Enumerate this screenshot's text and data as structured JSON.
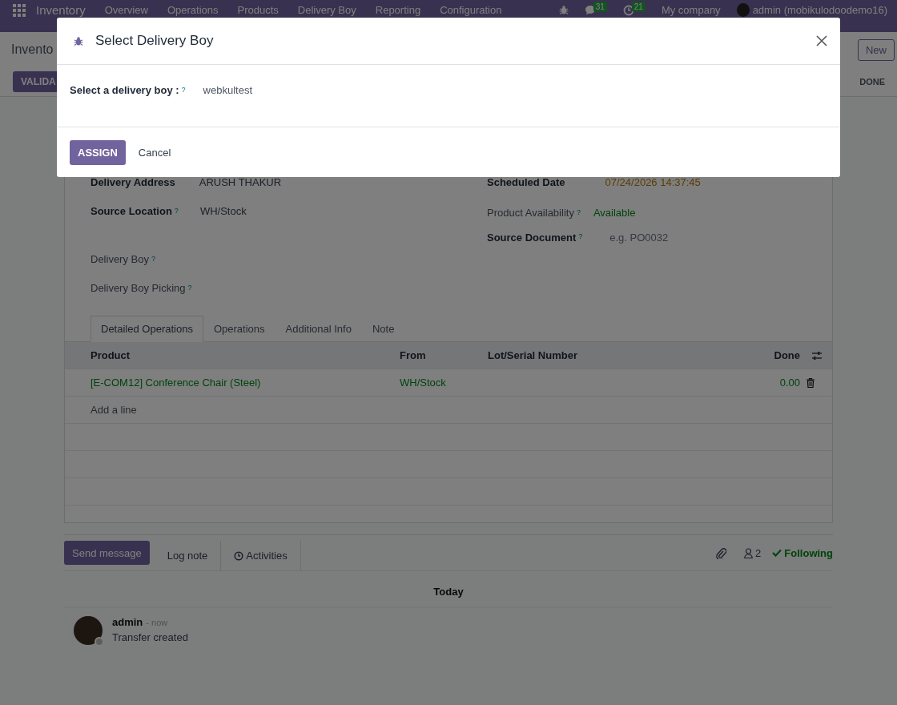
{
  "navbar": {
    "app": "Inventory",
    "menu": [
      "Overview",
      "Operations",
      "Products",
      "Delivery Boy",
      "Reporting",
      "Configuration"
    ],
    "messages_count": "31",
    "activities_count": "21",
    "company": "My company",
    "user": "admin (mobikulodoodemo16)"
  },
  "control_panel": {
    "breadcrumb": "Invento",
    "new_button": "New",
    "action_button": "VALIDA",
    "status": "DONE"
  },
  "form": {
    "left": [
      {
        "label": "Delivery Address",
        "required": true,
        "value": "ARUSH THAKUR",
        "kind": "text"
      },
      {
        "label": "Source Location",
        "required": true,
        "help": "?",
        "value": "WH/Stock",
        "kind": "text"
      },
      {
        "label": "Delivery Boy",
        "required": false,
        "help": "?",
        "kind": "text"
      },
      {
        "label": "Delivery Boy Picking",
        "required": false,
        "help": "?",
        "kind": "text"
      }
    ],
    "right": [
      {
        "label": "Scheduled Date",
        "required": true,
        "value": "07/24/2026 14:37:45",
        "kind": "date"
      },
      {
        "label": "Product Availability",
        "required": false,
        "help": "?",
        "value": "Available",
        "kind": "status"
      },
      {
        "label": "Source Document",
        "required": true,
        "help": "?",
        "placeholder": "e.g. PO0032",
        "kind": "input"
      }
    ]
  },
  "tabs": [
    {
      "label": "Detailed Operations",
      "selected": true
    },
    {
      "label": "Operations",
      "selected": false
    },
    {
      "label": "Additional Info",
      "selected": false
    },
    {
      "label": "Note",
      "selected": false
    }
  ],
  "table": {
    "columns": [
      "Product",
      "From",
      "Lot/Serial Number",
      "Done"
    ],
    "rows": [
      {
        "product": "[E-COM12] Conference Chair (Steel)",
        "from": "WH/Stock",
        "done": "0.00"
      }
    ],
    "add_line": "Add a line"
  },
  "chatter": {
    "buttons": [
      {
        "label": "Send message",
        "selected": true
      },
      {
        "label": "Log note",
        "selected": false
      },
      {
        "label": "Activities",
        "selected": false
      }
    ],
    "followers": "2",
    "following": "Following",
    "date_separator": "Today",
    "messages": [
      {
        "author": "admin",
        "time": "- now",
        "body": "Transfer created"
      }
    ]
  },
  "dialog": {
    "title": "Select Delivery Boy",
    "field_label": "Select a delivery boy :",
    "help": "?",
    "value": "webkultest",
    "buttons": [
      {
        "label": "ASSIGN",
        "kind": "primary"
      },
      {
        "label": "Cancel",
        "kind": "secondary"
      }
    ]
  }
}
